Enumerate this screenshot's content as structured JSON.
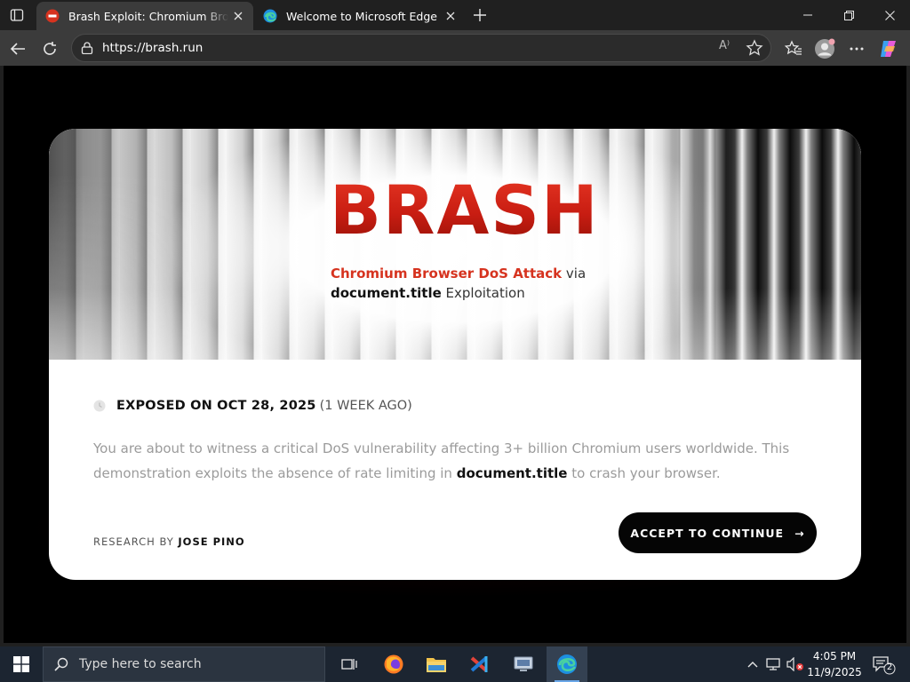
{
  "browser": {
    "tabs": [
      {
        "title": "Brash Exploit: Chromium Browser DoS Attack",
        "active": true
      },
      {
        "title": "Welcome to Microsoft Edge",
        "active": false
      }
    ],
    "address": {
      "url": "https://brash.run",
      "read_aloud_label": "A⁾"
    }
  },
  "page": {
    "brand": "BRASH",
    "subtitle": {
      "part1_red": "Chromium Browser DoS Attack",
      "part2": " via",
      "part3_bold": "document.title",
      "part4": " Exploitation"
    },
    "exposed": {
      "label": "EXPOSED ON OCT 28, 2025",
      "ago": "(1 WEEK AGO)"
    },
    "description": {
      "part1": "You are about to witness a critical DoS vulnerability affecting 3+ billion Chromium users worldwide. This demonstration exploits the absence of rate limiting in ",
      "keyword": "document.title",
      "part2": " to crash your browser."
    },
    "research": {
      "label": "RESEARCH BY ",
      "name": "JOSE PINO"
    },
    "cta": {
      "label": "ACCEPT TO CONTINUE",
      "arrow": "→"
    }
  },
  "taskbar": {
    "search_placeholder": "Type here to search",
    "time": "4:05 PM",
    "date": "11/9/2025",
    "notification_count": "2"
  },
  "colors": {
    "brand_red": "#d6331f",
    "cta_bg": "#050505",
    "edge_tab_active": "#3b3b3b"
  }
}
